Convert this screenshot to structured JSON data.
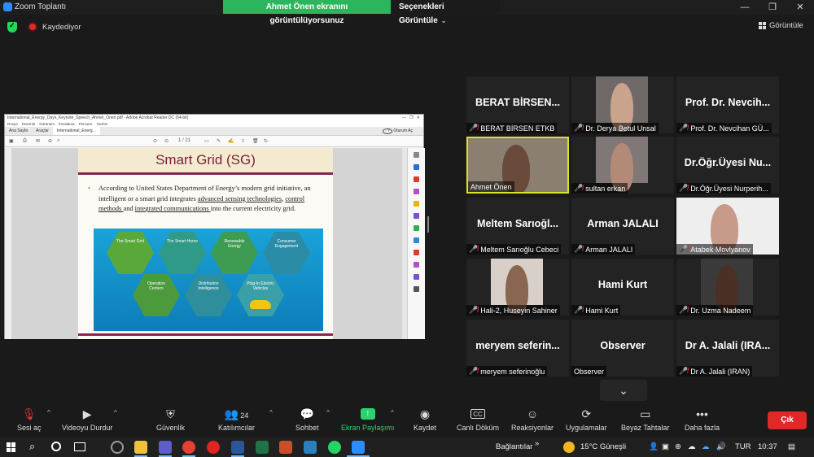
{
  "window": {
    "title": "Zoom Toplantı"
  },
  "share_banner": {
    "text": "Ahmet Önen ekranını görüntülüyorsunuz",
    "options_label": "Seçenekleri Görüntüle"
  },
  "status": {
    "recording_label": "Kaydediyor",
    "view_label": "Görüntüle"
  },
  "shared_screen": {
    "app_title": "International_Energy_Days_Keynote_Speech_Ahmet_Onen.pdf - Adobe Acrobat Reader DC (64-bit)",
    "menu": [
      "Dosya",
      "Düzenle",
      "Görünüm",
      "İmzalama",
      "Pencere",
      "Yardım"
    ],
    "tabs": [
      "Ana Sayfa",
      "Araçlar",
      "International_Energ..."
    ],
    "signin": "Oturum Aç",
    "page_indicator": "1 / 21",
    "slide": {
      "title": "Smart Grid (SG)",
      "text_a": "According to United States Department of Energy’s modern grid initiative, an intelligent or a smart grid integrates ",
      "link1": "advanced sensing technologies",
      "text_b": ", ",
      "link2": "control methods ",
      "text_c": "and ",
      "link3": "integrated communications ",
      "text_d": "into the current electricity grid.",
      "hex_labels": [
        "The Smart Grid",
        "The Smart Home",
        "Renewable Energy",
        "Consumer Engagement",
        "Operation Centers",
        "Distribution Intelligence",
        "Plug-In Electric Vehicles"
      ]
    }
  },
  "participants": [
    {
      "big": "BERAT BİRSEN...",
      "name": "BERAT BİRSEN ETKB",
      "muted": true,
      "video": false
    },
    {
      "big": "",
      "name": "Dr. Derya Betul Unsal",
      "muted": true,
      "video": true
    },
    {
      "big": "Prof. Dr. Nevcih...",
      "name": "Prof. Dr. Nevcihan GÜ...",
      "muted": true,
      "video": false
    },
    {
      "big": "",
      "name": "Ahmet Önen",
      "muted": false,
      "video": true,
      "active": true
    },
    {
      "big": "",
      "name": "sultan erkan",
      "muted": true,
      "video": true
    },
    {
      "big": "Dr.Öğr.Üyesi Nu...",
      "name": "Dr.Öğr.Üyesi Nurperih...",
      "muted": true,
      "video": false
    },
    {
      "big": "Meltem Sarıoğl...",
      "name": "Meltem Sarıoğlu Cebeci",
      "muted": true,
      "video": false
    },
    {
      "big": "Arman JALALI",
      "name": "Arman JALALI",
      "muted": true,
      "video": false
    },
    {
      "big": "",
      "name": "Atabek Movlyanov",
      "muted": true,
      "video": true
    },
    {
      "big": "",
      "name": "Hali-2, Huseyin Sahiner",
      "muted": true,
      "video": true
    },
    {
      "big": "Hami Kurt",
      "name": "Hami Kurt",
      "muted": true,
      "video": false
    },
    {
      "big": "",
      "name": "Dr. Uzma Nadeem",
      "muted": true,
      "video": true
    },
    {
      "big": "meryem seferin...",
      "name": "meryem seferinoğlu",
      "muted": true,
      "video": false
    },
    {
      "big": "Observer",
      "name": "Observer",
      "muted": false,
      "video": false
    },
    {
      "big": "Dr A. Jalali (IRA...",
      "name": "Dr A. Jalali (IRAN)",
      "muted": true,
      "video": false
    }
  ],
  "toolbar": {
    "unmute": "Sesi aç",
    "stop_video": "Videoyu Durdur",
    "security": "Güvenlik",
    "participants": "Katılımcılar",
    "participants_count": "24",
    "chat": "Sohbet",
    "share": "Ekran Paylaşımı",
    "record": "Kaydet",
    "captions": "Canlı Döküm",
    "reactions": "Reaksiyonlar",
    "apps": "Uygulamalar",
    "whiteboard": "Beyaz Tahtalar",
    "more": "Daha fazla",
    "leave": "Çık",
    "captions_icon_text": "CC"
  },
  "taskbar": {
    "links": "Bağlantılar",
    "weather": "15°C  Güneşli",
    "lang": "TUR",
    "time": "10:37"
  }
}
